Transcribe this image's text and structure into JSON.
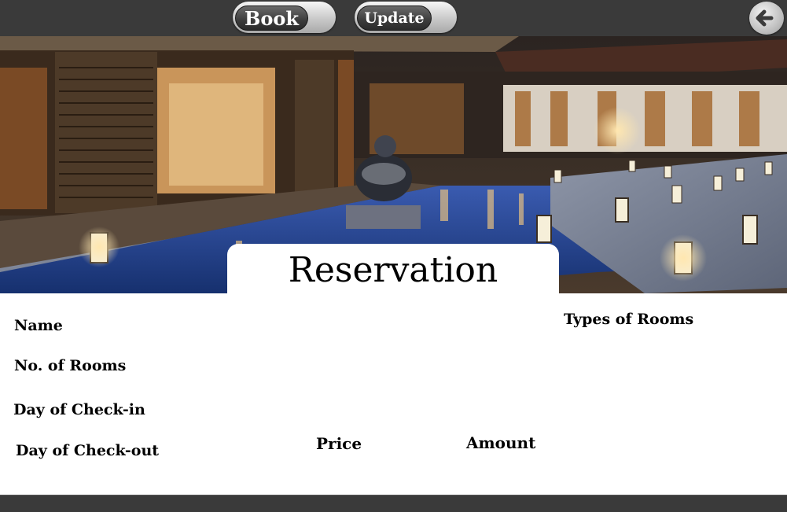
{
  "toolbar": {
    "book_label": "Book",
    "update_label": "Update"
  },
  "header": {
    "title": "Reservation"
  },
  "form": {
    "name_label": "Name",
    "rooms_label": "No. of Rooms",
    "checkin_label": "Day of Check-in",
    "checkout_label": "Day of Check-out",
    "price_label": "Price",
    "amount_label": "Amount",
    "room_types_label": "Types of Rooms"
  },
  "colors": {
    "bar": "#3a3a3a",
    "accent_water": "#23489a"
  },
  "icons": {
    "back": "arrow-left-icon"
  }
}
